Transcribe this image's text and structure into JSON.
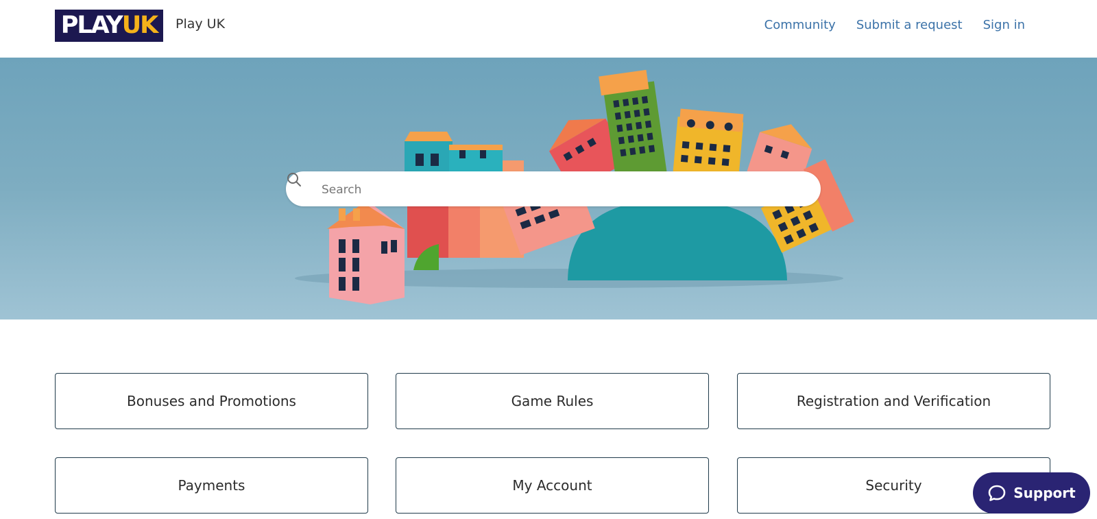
{
  "header": {
    "logo": {
      "part1": "PLAY",
      "part2": "UK"
    },
    "brand_name": "Play UK",
    "nav": [
      "Community",
      "Submit a request",
      "Sign in"
    ]
  },
  "search": {
    "placeholder": "Search",
    "icon": "search-icon"
  },
  "categories": [
    "Bonuses and Promotions",
    "Game Rules",
    "Registration and Verification",
    "Payments",
    "My Account",
    "Security"
  ],
  "support": {
    "label": "Support",
    "icon": "chat-bubble-icon"
  },
  "colors": {
    "logo_bg": "#1c1850",
    "logo_accent": "#f5b21a",
    "link": "#3b72a8",
    "hero_bg": "#7eadc1",
    "support_bg": "#2a2473"
  }
}
